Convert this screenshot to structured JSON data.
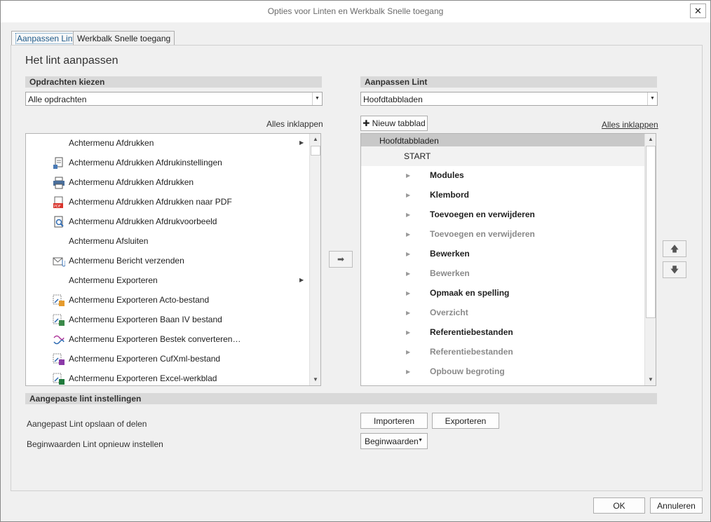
{
  "window": {
    "title": "Opties voor Linten en Werkbalk Snelle toegang",
    "close_glyph": "✕"
  },
  "tabs": [
    {
      "label": "Aanpassen Lint"
    },
    {
      "label": "Werkbalk Snelle toegang"
    }
  ],
  "page_heading": "Het lint aanpassen",
  "left": {
    "header": "Opdrachten kiezen",
    "combo_value": "Alle opdrachten",
    "collapse_all": "Alles inklappen",
    "items": [
      {
        "label": "Achtermenu Afdrukken",
        "icon": "none",
        "submenu": true
      },
      {
        "label": "Achtermenu Afdrukken Afdrukinstellingen",
        "icon": "print-settings-icon",
        "submenu": false
      },
      {
        "label": "Achtermenu Afdrukken Afdrukken",
        "icon": "printer-icon",
        "submenu": false
      },
      {
        "label": "Achtermenu Afdrukken Afdrukken naar PDF",
        "icon": "pdf-icon",
        "submenu": false
      },
      {
        "label": "Achtermenu Afdrukken Afdrukvoorbeeld",
        "icon": "print-preview-icon",
        "submenu": false
      },
      {
        "label": "Achtermenu Afsluiten",
        "icon": "none",
        "submenu": false
      },
      {
        "label": "Achtermenu Bericht verzenden",
        "icon": "mail-attachment-icon",
        "submenu": false
      },
      {
        "label": "Achtermenu Exporteren",
        "icon": "none",
        "submenu": true
      },
      {
        "label": "Achtermenu Exporteren Acto-bestand",
        "icon": "export-acto-icon",
        "submenu": false
      },
      {
        "label": "Achtermenu Exporteren Baan IV bestand",
        "icon": "export-baan-icon",
        "submenu": false
      },
      {
        "label": "Achtermenu  Exporteren  Bestek  converteren…",
        "icon": "convert-icon",
        "submenu": false
      },
      {
        "label": "Achtermenu Exporteren CufXml-bestand",
        "icon": "export-cufxml-icon",
        "submenu": false
      },
      {
        "label": "Achtermenu Exporteren Excel-werkblad",
        "icon": "export-excel-icon",
        "submenu": false
      }
    ]
  },
  "right": {
    "header": "Aanpassen Lint",
    "combo_value": "Hoofdtabbladen",
    "new_tab_label": "Nieuw tabblad",
    "collapse_all": "Alles inklappen",
    "tree_root": "Hoofdtabbladen",
    "tree_tab": "START",
    "groups": [
      {
        "label": "Modules",
        "dim": false
      },
      {
        "label": "Klembord",
        "dim": false
      },
      {
        "label": "Toevoegen en verwijderen",
        "dim": false
      },
      {
        "label": "Toevoegen en verwijderen",
        "dim": true
      },
      {
        "label": "Bewerken",
        "dim": false
      },
      {
        "label": "Bewerken",
        "dim": true
      },
      {
        "label": "Opmaak en spelling",
        "dim": false
      },
      {
        "label": "Overzicht",
        "dim": true
      },
      {
        "label": "Referentiebestanden",
        "dim": false
      },
      {
        "label": "Referentiebestanden",
        "dim": true
      },
      {
        "label": "Opbouw begroting",
        "dim": true
      }
    ]
  },
  "bottom": {
    "header": "Aangepaste lint instellingen",
    "save_share_label": "Aangepast Lint opslaan of delen",
    "import_label": "Importeren",
    "export_label": "Exporteren",
    "reset_label": "Beginwaarden Lint opnieuw instellen",
    "reset_button": "Beginwaarden"
  },
  "footer": {
    "ok_label": "OK",
    "cancel_label": "Annuleren"
  }
}
